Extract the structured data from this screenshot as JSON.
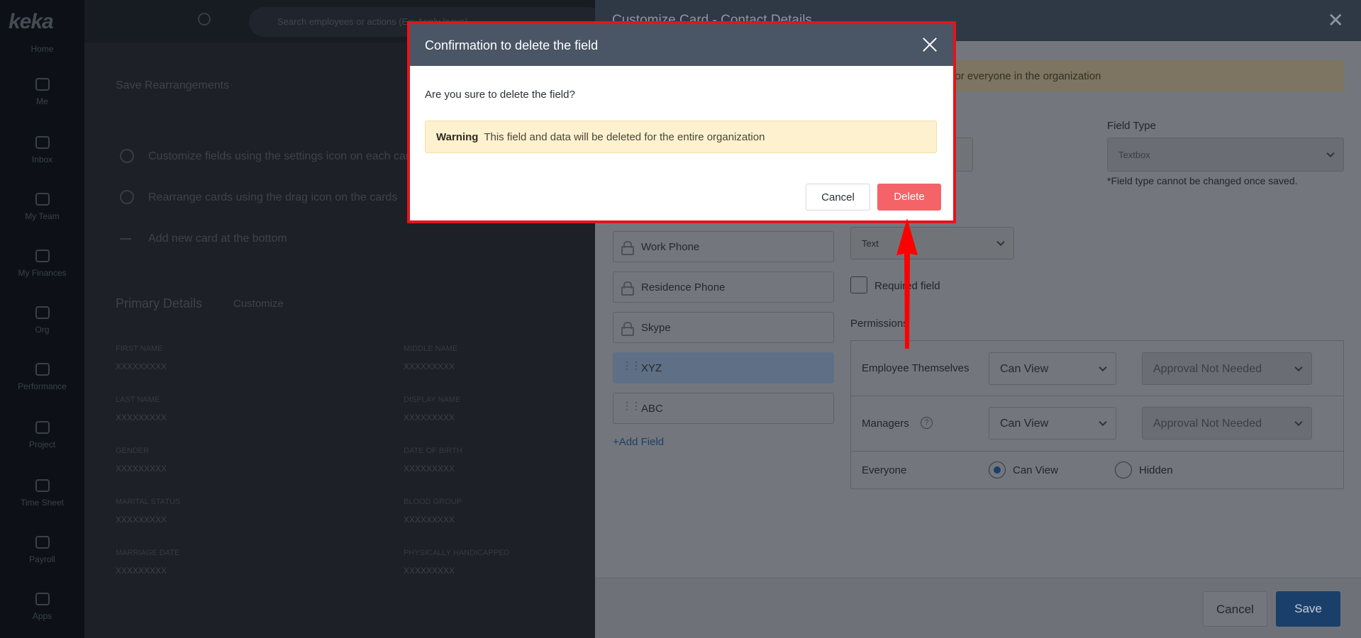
{
  "app": {
    "logo": "keka",
    "nav": [
      "Home",
      "Me",
      "Inbox",
      "My Team",
      "My Finances",
      "Org",
      "Performance",
      "Project",
      "Time Sheet",
      "Payroll",
      "Apps"
    ],
    "search_placeholder": "Search employees or actions (Ex: Apply leave)"
  },
  "background": {
    "save_rearrangements": "Save Rearrangements",
    "tips": [
      "Customize fields using the settings icon on each card",
      "Rearrange cards using the drag icon on the cards",
      "Add new card at the bottom"
    ],
    "section_title": "Primary Details",
    "customize_link": "Customize",
    "fields": [
      {
        "label": "FIRST NAME",
        "value": "XXXXXXXXX"
      },
      {
        "label": "MIDDLE NAME",
        "value": "XXXXXXXXX"
      },
      {
        "label": "LAST NAME",
        "value": "XXXXXXXXX"
      },
      {
        "label": "DISPLAY NAME",
        "value": "XXXXXXXXX"
      },
      {
        "label": "GENDER",
        "value": "XXXXXXXXX"
      },
      {
        "label": "DATE OF BIRTH",
        "value": "XXXXXXXXX"
      },
      {
        "label": "MARITAL STATUS",
        "value": "XXXXXXXXX"
      },
      {
        "label": "BLOOD GROUP",
        "value": "XXXXXXXXX"
      },
      {
        "label": "MARRIAGE DATE",
        "value": "XXXXXXXXX"
      },
      {
        "label": "PHYSICALLY HANDICAPPED",
        "value": "XXXXXXXXX"
      }
    ]
  },
  "drawer": {
    "title": "Customize Card - Contact Details",
    "banner": "customizing the settings for everyone in the organization",
    "field_type_label": "Field Type",
    "field_type_value": "Textbox",
    "field_type_note": "*Field type cannot be changed once saved.",
    "text_select": "Text",
    "required_label": "Required field",
    "fields": [
      {
        "label": "Work Phone",
        "locked": true
      },
      {
        "label": "Residence Phone",
        "locked": true
      },
      {
        "label": "Skype",
        "locked": true
      },
      {
        "label": "XYZ",
        "locked": false
      },
      {
        "label": "ABC",
        "locked": false
      }
    ],
    "add_field": "+Add Field",
    "permissions_label": "Permissions",
    "permissions": [
      {
        "who": "Employee Themselves",
        "access": "Can View",
        "approval": "Approval Not Needed"
      },
      {
        "who": "Managers",
        "access": "Can View",
        "approval": "Approval Not Needed"
      }
    ],
    "everyone": {
      "who": "Everyone",
      "option_view": "Can View",
      "option_hidden": "Hidden"
    },
    "cancel": "Cancel",
    "save": "Save"
  },
  "modal": {
    "title": "Confirmation to delete the field",
    "question": "Are you sure to delete the field?",
    "warning_label": "Warning",
    "warning_text": "This field and data will be deleted for the entire organization",
    "cancel": "Cancel",
    "delete": "Delete"
  },
  "colors": {
    "modal_header": "#4a5565",
    "delete_button": "#f46367",
    "highlight_border": "#e4141c",
    "save_button": "#1a3f6b",
    "warning_bg": "#fdf1cf"
  }
}
